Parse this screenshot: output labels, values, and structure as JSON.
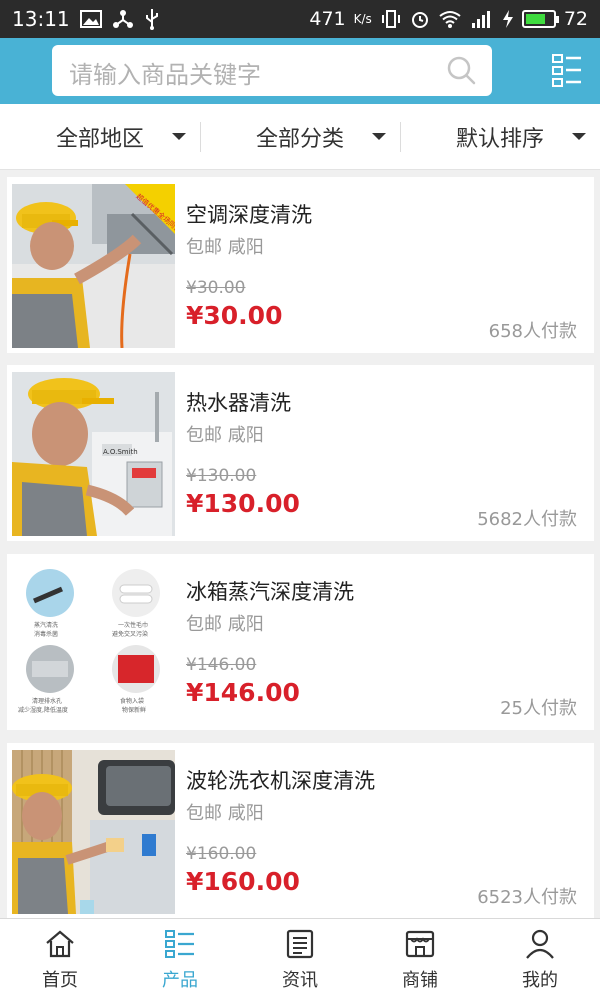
{
  "status_bar": {
    "time": "13:11",
    "net_speed": "471",
    "net_unit": "K/s",
    "battery": "72",
    "battery_level": 0.72
  },
  "search": {
    "placeholder": "请输入商品关键字"
  },
  "filters": [
    {
      "label": "全部地区"
    },
    {
      "label": "全部分类"
    },
    {
      "label": "默认排序"
    }
  ],
  "products": [
    {
      "title": "空调深度清洗",
      "location": "包邮 咸阳",
      "old_price": "¥30.00",
      "price": "¥30.00",
      "sales": "658人付款"
    },
    {
      "title": "热水器清洗",
      "location": "包邮 咸阳",
      "old_price": "¥130.00",
      "price": "¥130.00",
      "sales": "5682人付款"
    },
    {
      "title": "冰箱蒸汽深度清洗",
      "location": "包邮 咸阳",
      "old_price": "¥146.00",
      "price": "¥146.00",
      "sales": "25人付款"
    },
    {
      "title": "波轮洗衣机深度清洗",
      "location": "包邮 咸阳",
      "old_price": "¥160.00",
      "price": "¥160.00",
      "sales": "6523人付款"
    }
  ],
  "thumbs": {
    "banner_text": "超值优惠全场同价",
    "water_brand": "A.O.Smith",
    "fridge_labels": [
      "蒸汽清洗",
      "消毒杀菌",
      "一次性毛巾",
      "避免交叉污染",
      "清理排水孔",
      "减少湿度,降低温度",
      "食物入袋",
      "物保新鲜"
    ]
  },
  "tabbar": [
    {
      "label": "首页",
      "icon": "home-icon",
      "active": false
    },
    {
      "label": "产品",
      "icon": "product-list-icon",
      "active": true
    },
    {
      "label": "资讯",
      "icon": "news-icon",
      "active": false
    },
    {
      "label": "商铺",
      "icon": "shop-icon",
      "active": false
    },
    {
      "label": "我的",
      "icon": "user-icon",
      "active": false
    }
  ],
  "colors": {
    "header": "#49b2d5",
    "price": "#d8202a",
    "tab_active": "#3aa7d0"
  }
}
